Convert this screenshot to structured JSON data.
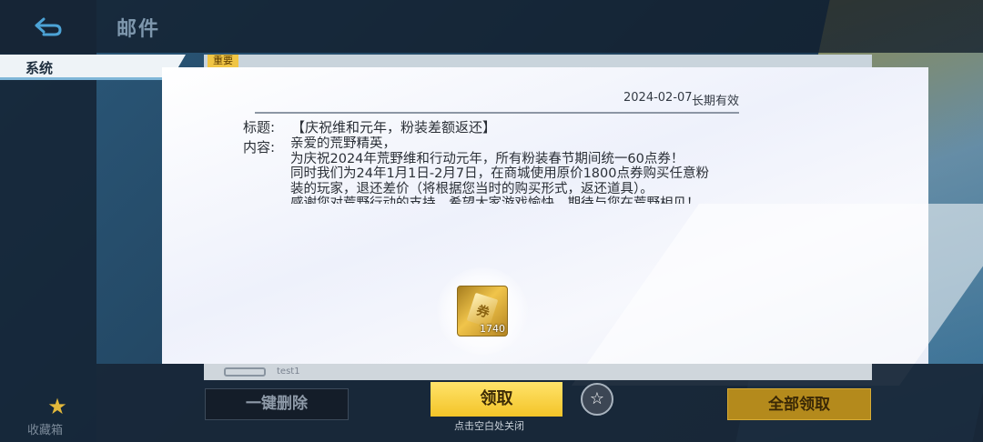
{
  "header": {
    "title": "邮件"
  },
  "sidebar": {
    "system_tab": "系统",
    "favorites_label": "收藏箱"
  },
  "mail_list": {
    "important_tag": "重要",
    "behind_row_text": "test1"
  },
  "mail": {
    "date": "2024-02-07",
    "validity": "长期有效",
    "subject_label": "标题:",
    "subject": "【庆祝维和元年，粉装差额返还】",
    "content_label": "内容:",
    "content_lines": [
      "亲爱的荒野精英，",
      "为庆祝2024年荒野维和行动元年，所有粉装春节期间统一60点券！",
      "同时我们为24年1月1日-2月7日，在商城使用原价1800点券购买任意粉",
      "装的玩家，退还差价（将根据您当时的购买形式，返还道具）。",
      "感谢您对荒野行动的支持，希望大家游戏愉快，期待与您在荒野相见！"
    ]
  },
  "reward": {
    "icon": "ticket-icon",
    "count": "1740"
  },
  "footer": {
    "delete_all_label": "一键删除",
    "claim_label": "领取",
    "claim_all_label": "全部领取",
    "close_hint": "点击空白处关闭"
  },
  "colors": {
    "claim_button": "#f3c428",
    "claim_all_button": "#b48a1c",
    "dialog_bg": "#f3f5fb"
  }
}
